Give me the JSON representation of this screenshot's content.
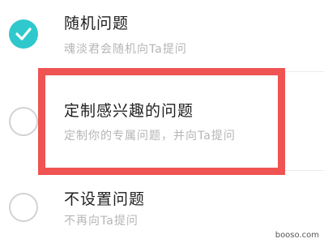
{
  "options": [
    {
      "title": "随机问题",
      "subtitle": "魂淡君会随机向Ta提问",
      "selected": true
    },
    {
      "title": "定制感兴趣的问题",
      "subtitle": "定制你的专属问题，并向Ta提问",
      "selected": false
    },
    {
      "title": "不设置问题",
      "subtitle": "不再向Ta提问",
      "selected": false
    }
  ],
  "icons": {
    "selected": "check-icon"
  },
  "colors": {
    "accent": "#2fc8cc",
    "highlight_border": "#ef5352"
  },
  "watermark": "booso.com"
}
